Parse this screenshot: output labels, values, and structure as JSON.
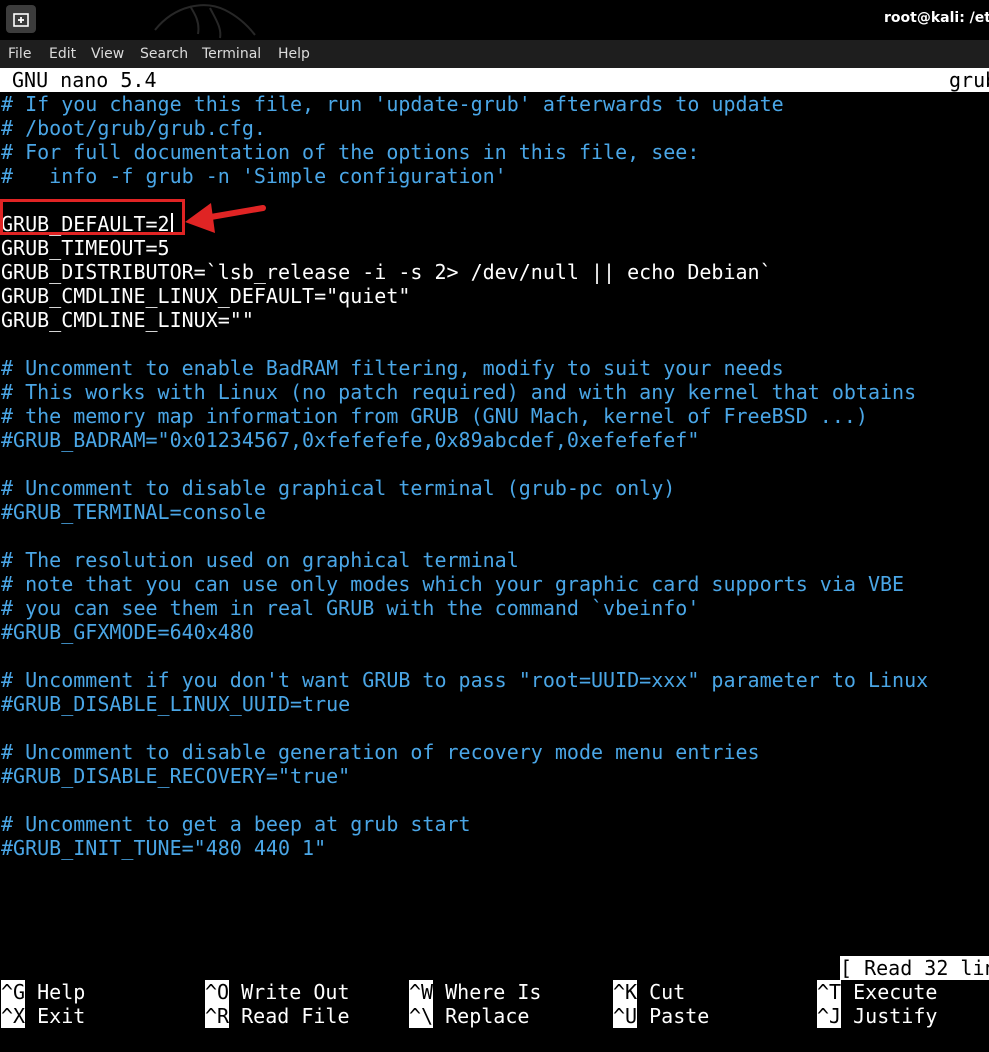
{
  "window": {
    "title": "root@kali: /etc/",
    "new_tab_icon": "new-tab-icon",
    "background_logo": "kali-dragon-icon"
  },
  "menu": [
    "File",
    "Edit",
    "View",
    "Search",
    "Terminal",
    "Help"
  ],
  "nano": {
    "version_label": "GNU nano 5.4",
    "filename": "grub",
    "status_message": "[ Read 32 lin"
  },
  "editor_lines": [
    {
      "text": "# If you change this file, run 'update-grub' afterwards to update",
      "type": "comment"
    },
    {
      "text": "# /boot/grub/grub.cfg.",
      "type": "comment"
    },
    {
      "text": "# For full documentation of the options in this file, see:",
      "type": "comment"
    },
    {
      "text": "#   info -f grub -n 'Simple configuration'",
      "type": "comment"
    },
    {
      "text": "",
      "type": "code"
    },
    {
      "text": "GRUB_DEFAULT=2",
      "type": "code",
      "cursor": true
    },
    {
      "text": "GRUB_TIMEOUT=5",
      "type": "code"
    },
    {
      "text": "GRUB_DISTRIBUTOR=`lsb_release -i -s 2> /dev/null || echo Debian`",
      "type": "code"
    },
    {
      "text": "GRUB_CMDLINE_LINUX_DEFAULT=\"quiet\"",
      "type": "code"
    },
    {
      "text": "GRUB_CMDLINE_LINUX=\"\"",
      "type": "code"
    },
    {
      "text": "",
      "type": "code"
    },
    {
      "text": "# Uncomment to enable BadRAM filtering, modify to suit your needs",
      "type": "comment"
    },
    {
      "text": "# This works with Linux (no patch required) and with any kernel that obtains",
      "type": "comment"
    },
    {
      "text": "# the memory map information from GRUB (GNU Mach, kernel of FreeBSD ...)",
      "type": "comment"
    },
    {
      "text": "#GRUB_BADRAM=\"0x01234567,0xfefefefe,0x89abcdef,0xefefefef\"",
      "type": "comment"
    },
    {
      "text": "",
      "type": "code"
    },
    {
      "text": "# Uncomment to disable graphical terminal (grub-pc only)",
      "type": "comment"
    },
    {
      "text": "#GRUB_TERMINAL=console",
      "type": "comment"
    },
    {
      "text": "",
      "type": "code"
    },
    {
      "text": "# The resolution used on graphical terminal",
      "type": "comment"
    },
    {
      "text": "# note that you can use only modes which your graphic card supports via VBE",
      "type": "comment"
    },
    {
      "text": "# you can see them in real GRUB with the command `vbeinfo'",
      "type": "comment"
    },
    {
      "text": "#GRUB_GFXMODE=640x480",
      "type": "comment"
    },
    {
      "text": "",
      "type": "code"
    },
    {
      "text": "# Uncomment if you don't want GRUB to pass \"root=UUID=xxx\" parameter to Linux",
      "type": "comment"
    },
    {
      "text": "#GRUB_DISABLE_LINUX_UUID=true",
      "type": "comment"
    },
    {
      "text": "",
      "type": "code"
    },
    {
      "text": "# Uncomment to disable generation of recovery mode menu entries",
      "type": "comment"
    },
    {
      "text": "#GRUB_DISABLE_RECOVERY=\"true\"",
      "type": "comment"
    },
    {
      "text": "",
      "type": "code"
    },
    {
      "text": "# Uncomment to get a beep at grub start",
      "type": "comment"
    },
    {
      "text": "#GRUB_INIT_TUNE=\"480 440 1\"",
      "type": "comment"
    }
  ],
  "shortcuts": [
    {
      "key": "^G",
      "label": "Help"
    },
    {
      "key": "^O",
      "label": "Write Out"
    },
    {
      "key": "^W",
      "label": "Where Is"
    },
    {
      "key": "^K",
      "label": "Cut"
    },
    {
      "key": "^T",
      "label": "Execute"
    },
    {
      "key": "^X",
      "label": "Exit"
    },
    {
      "key": "^R",
      "label": "Read File"
    },
    {
      "key": "^\\",
      "label": "Replace"
    },
    {
      "key": "^U",
      "label": "Paste"
    },
    {
      "key": "^J",
      "label": "Justify"
    }
  ],
  "annotation": {
    "highlight_color": "#e02424",
    "arrow_icon": "red-arrow-icon"
  },
  "colors": {
    "comment": "#4aa6e6",
    "text": "#ffffff",
    "background": "#000000"
  }
}
